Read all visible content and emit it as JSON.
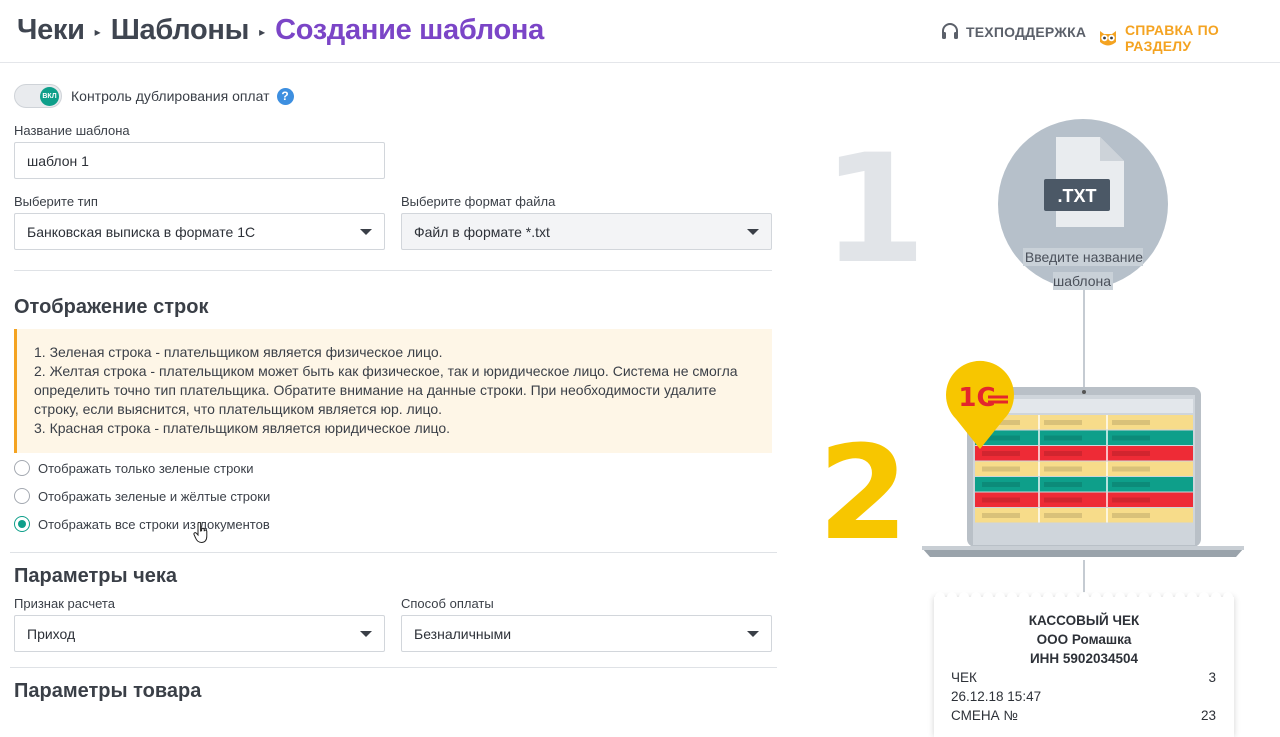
{
  "breadcrumb": {
    "items": [
      "Чеки",
      "Шаблоны",
      "Создание шаблона"
    ],
    "separator": "▸"
  },
  "header": {
    "support_label": "ТЕХПОДДЕРЖКА",
    "help_label": "СПРАВКА ПО РАЗДЕЛУ"
  },
  "toggle": {
    "knob_text": "ВКЛ",
    "label": "Контроль дублирования оплат",
    "help": "?",
    "state": "on"
  },
  "template_name": {
    "label": "Название шаблона",
    "value": "шаблон 1"
  },
  "type_select": {
    "label": "Выберите тип",
    "value": "Банковская выписка в формате 1С"
  },
  "format_select": {
    "label": "Выберите формат файла",
    "value": "Файл в формате *.txt"
  },
  "rows_section": {
    "title": "Отображение строк",
    "note": [
      "1. Зеленая строка - плательщиком является физическое лицо.",
      "2. Желтая строка - плательщиком может быть как физическое, так и юридическое лицо. Система не смогла определить точно тип плательщика. Обратите внимание на данные строки. При необходимости удалите строку, если выяснится, что плательщиком является юр. лицо.",
      "3. Красная строка - плательщиком является юридическое лицо."
    ],
    "options": [
      {
        "label": "Отображать только зеленые строки",
        "checked": false
      },
      {
        "label": "Отображать зеленые и жёлтые строки",
        "checked": false
      },
      {
        "label": "Отображать все строки из документов",
        "checked": true
      }
    ]
  },
  "receipt_params": {
    "title": "Параметры чека",
    "calc_label": "Признак расчета",
    "calc_value": "Приход",
    "payment_label": "Способ оплаты",
    "payment_value": "Безналичными"
  },
  "product_params": {
    "title": "Параметры товара"
  },
  "illustration": {
    "step1": "1",
    "step2": "2",
    "file_ext": ".TXT",
    "caption": "Введите название шаблона",
    "logo_text": "1С",
    "table_rows": [
      "yellow",
      "green",
      "red",
      "yellow",
      "green",
      "red",
      "yellow"
    ],
    "colors": {
      "green": "#0e9f8a",
      "yellow": "#f7dc8a",
      "red": "#ee2b36",
      "accent": "#7b45c7",
      "orange": "#f4a321"
    },
    "receipt": {
      "title": "КАССОВЫЙ ЧЕК",
      "company": "ООО Ромашка",
      "inn": "ИНН 5902034504",
      "rows": [
        {
          "left": "ЧЕК",
          "right": "3"
        },
        {
          "left": "26.12.18 15:47",
          "right": ""
        },
        {
          "left": "СМЕНА №",
          "right": "23"
        }
      ]
    }
  }
}
